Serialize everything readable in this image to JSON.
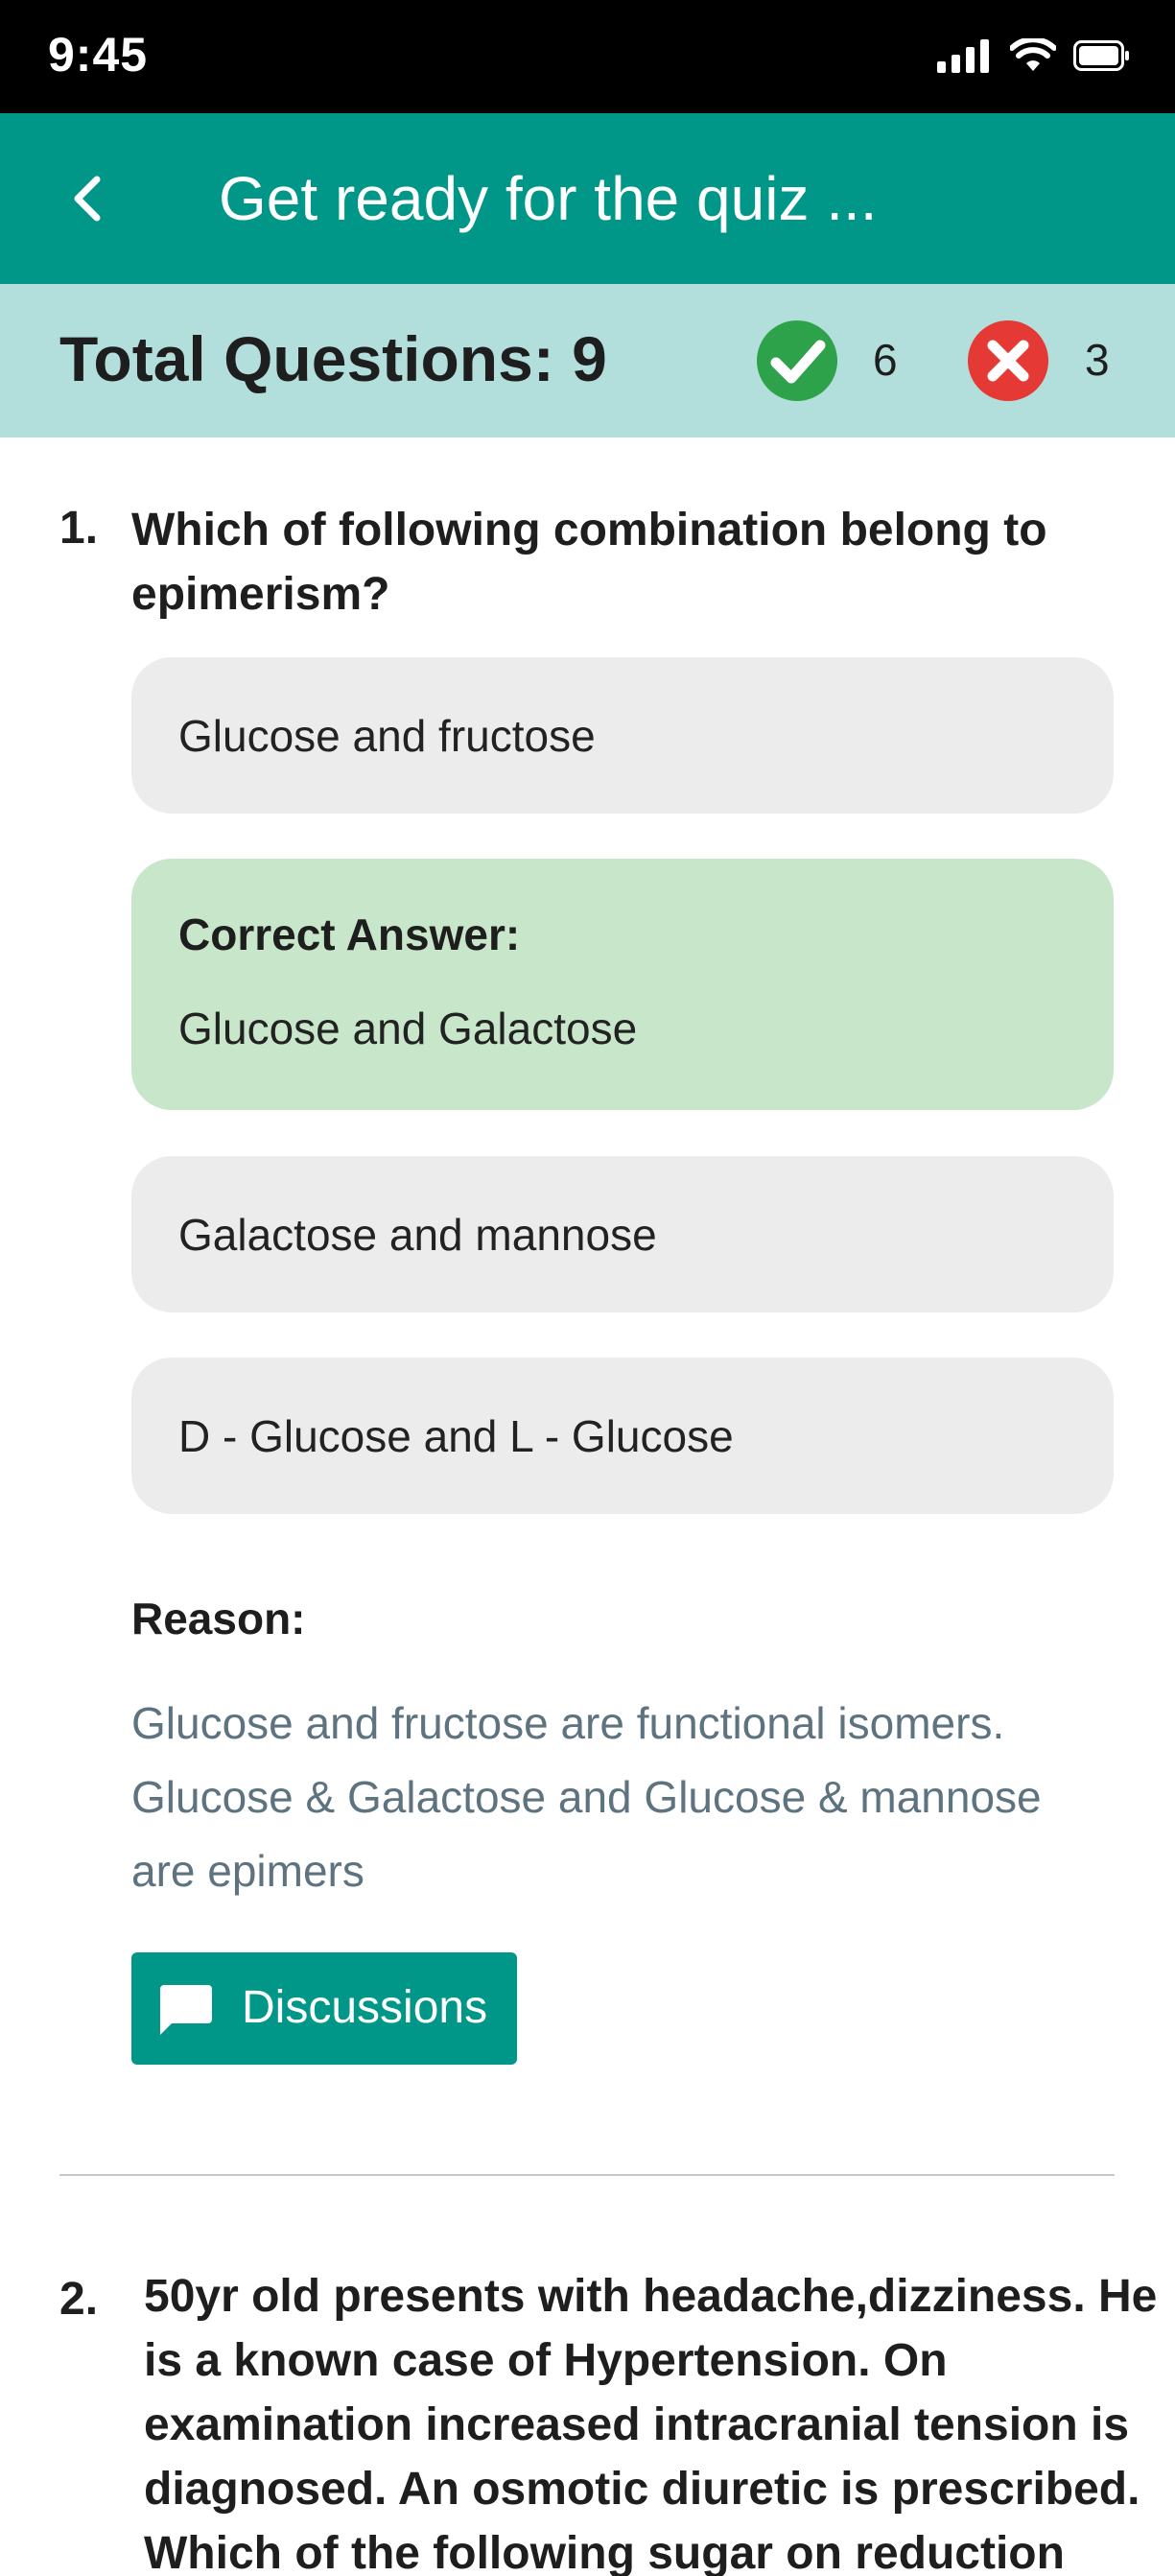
{
  "status_bar": {
    "time": "9:45",
    "icons": [
      "signal-icon",
      "wifi-icon",
      "battery-icon"
    ]
  },
  "app_bar": {
    "back_icon": "chevron-left-icon",
    "title": "Get ready for the quiz ..."
  },
  "summary": {
    "total_questions": "Total Questions: 9",
    "correct_count": "6",
    "wrong_count": "3",
    "correct_color": "#2ea24a",
    "wrong_color": "#e53935"
  },
  "questions": [
    {
      "number": "1.",
      "text_line1": "Which of following combination belong to",
      "text_line2": "epimerism?",
      "options": [
        "Glucose and fructose",
        "Glucose and Galactose",
        "Galactose and mannose",
        "D - Glucose and L - Glucose"
      ],
      "correct_label": "Correct Answer:",
      "reason_label": "Reason:",
      "reason_lines": [
        "Glucose and fructose are functional isomers.",
        "Glucose & Galactose and Glucose & mannose",
        "are epimers"
      ],
      "discussions_label": "Discussions"
    },
    {
      "number": "2.",
      "text_lines": [
        "50yr old presents with headache,dizziness. He",
        "is a known case of Hypertension. On",
        "examination increased intracranial tension is",
        "diagnosed. An osmotic diuretic is prescribed.",
        "Which of the following sugar on reduction"
      ]
    }
  ],
  "colors": {
    "status_bar": "#000000",
    "app_bar": "#009688",
    "summary_band": "#b2dfdb",
    "option_bg": "#ececec",
    "correct_option_bg": "#c8e6c9",
    "reason_text": "#5d7380"
  }
}
